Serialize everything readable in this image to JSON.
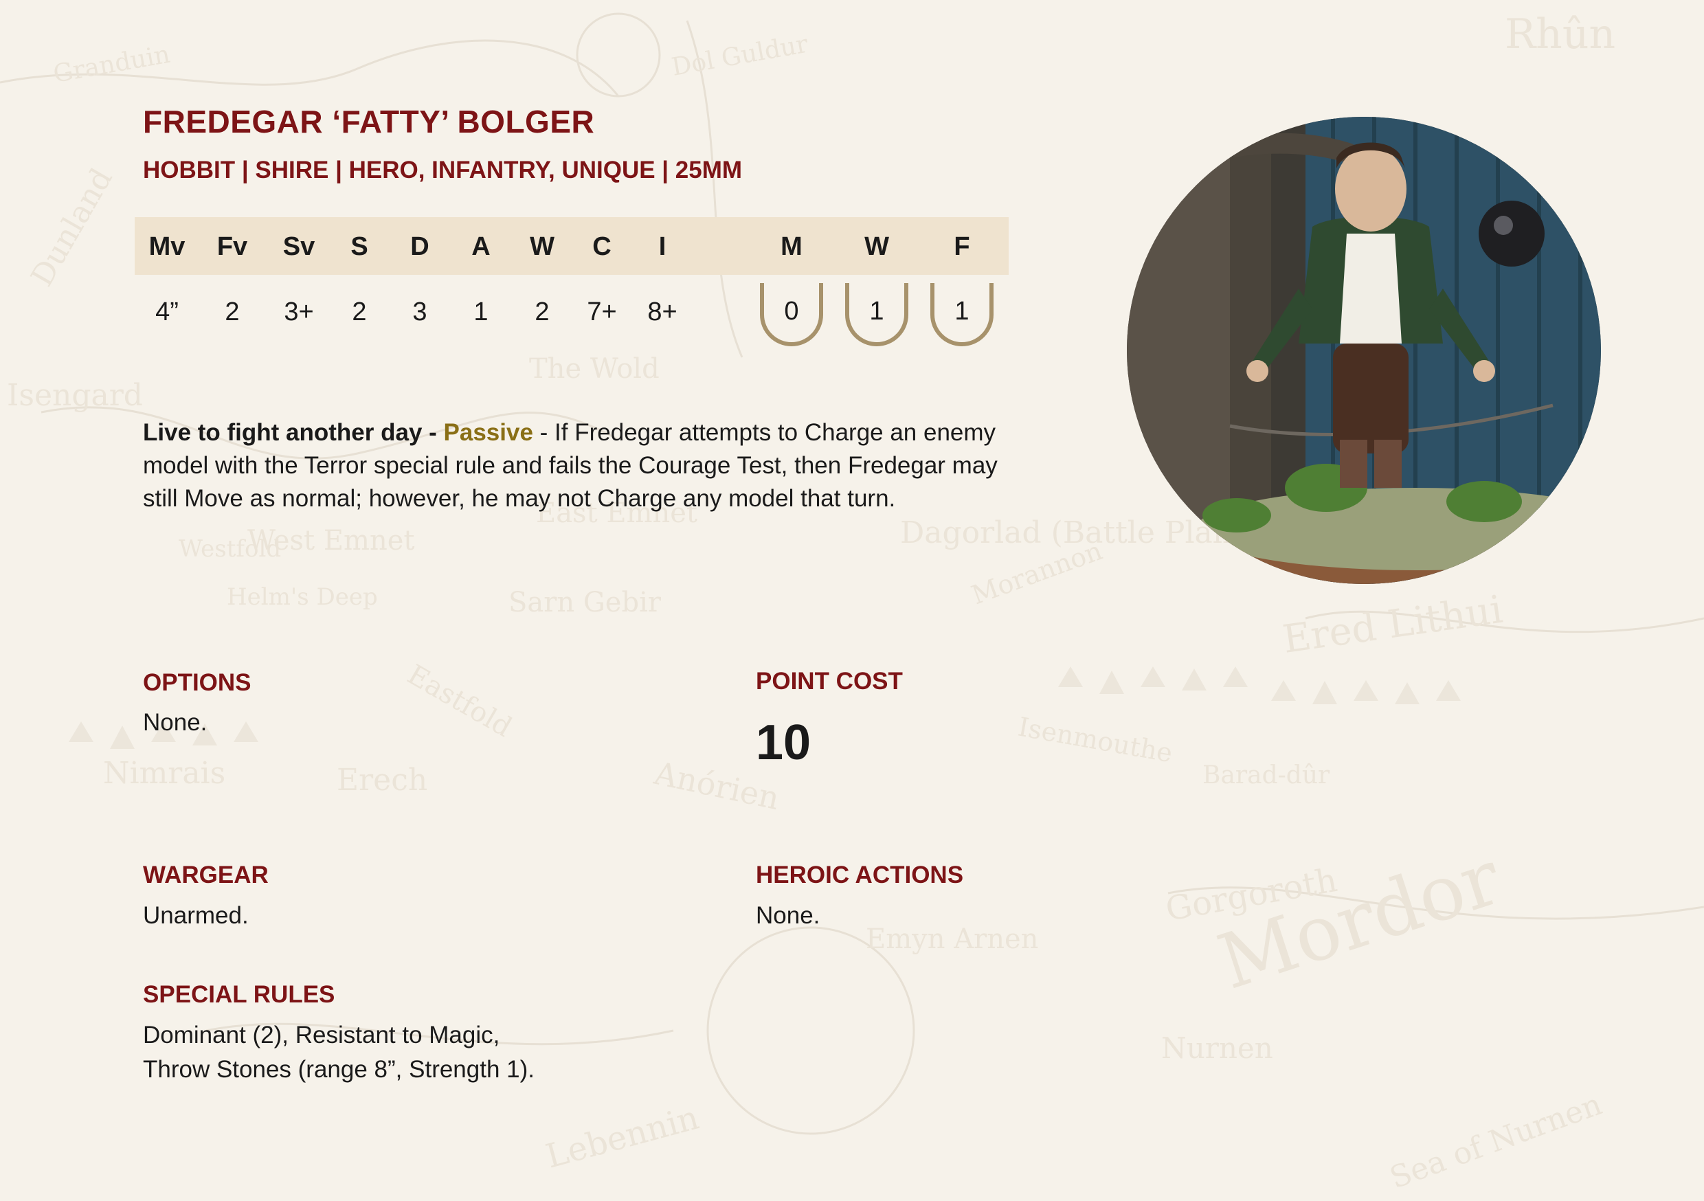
{
  "card": {
    "name": "FREDEGAR ‘FATTY’ BOLGER",
    "keywords": "HOBBIT | SHIRE | HERO, INFANTRY, UNIQUE | 25MM"
  },
  "stats": {
    "headers": [
      "Mv",
      "Fv",
      "Sv",
      "S",
      "D",
      "A",
      "W",
      "C",
      "I"
    ],
    "values": [
      "4”",
      "2",
      "3+",
      "2",
      "3",
      "1",
      "2",
      "7+",
      "8+"
    ]
  },
  "heroic": {
    "headers": [
      "M",
      "W",
      "F"
    ],
    "values": [
      "0",
      "1",
      "1"
    ]
  },
  "special_rule": {
    "name": "Live to fight another day -",
    "type": "Passive",
    "text": "- If Fredegar attempts to Charge an enemy model with the Terror special rule and fails the Courage Test, then Fredegar may still Move as normal; however, he may not Charge any model that turn."
  },
  "options": {
    "heading": "OPTIONS",
    "text": "None."
  },
  "point_cost": {
    "heading": "POINT COST",
    "value": "10"
  },
  "wargear": {
    "heading": "WARGEAR",
    "text": "Unarmed."
  },
  "heroic_actions": {
    "heading": "HEROIC ACTIONS",
    "text": "None."
  },
  "special_rules": {
    "heading": "SPECIAL RULES",
    "line1": "Dominant (2), Resistant to Magic,",
    "line2": "Throw Stones (range 8”, Strength 1)."
  },
  "colors": {
    "heading_red": "#7d1416",
    "passive_gold": "#8a6f16",
    "stat_band": "#efe3cf",
    "shield_outline": "#a7926b",
    "background": "#f6f2ea"
  },
  "map_labels": [
    "Rhûn",
    "Mordor",
    "Isengard",
    "Dagorlad (Battle Plain)",
    "Ered Lithui",
    "Gorgoroth",
    "Nurnen",
    "Sea of Nurnen",
    "Barad-dûr",
    "Erech",
    "Nimrais",
    "Anórien",
    "Emyn Arnen",
    "Lebennin",
    "The Wold",
    "West Emnet",
    "East Emnet",
    "Sarn Gebir",
    "Morannon",
    "Isenmouthe",
    "Dol Guldur",
    "Dunland",
    "Granduin",
    "Westfold",
    "Eastfold",
    "Helm's Deep"
  ]
}
